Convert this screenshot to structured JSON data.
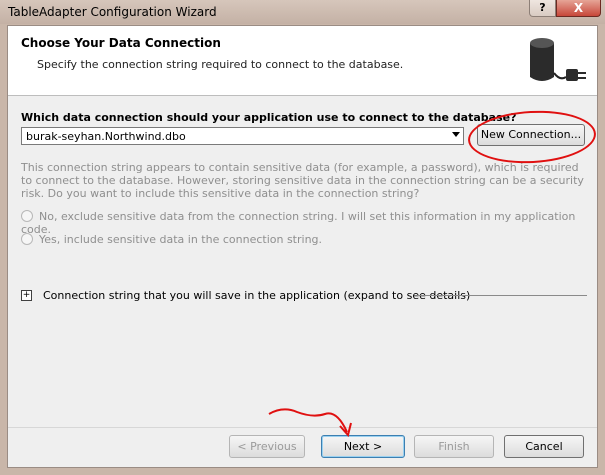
{
  "window": {
    "title": "TableAdapter Configuration Wizard",
    "help_glyph": "?",
    "close_glyph": "X"
  },
  "header": {
    "title": "Choose Your Data Connection",
    "subtitle": "Specify the connection string required to connect to the database."
  },
  "connection": {
    "question": "Which data connection should your application use to connect to the database?",
    "selected_connection": "burak-seyhan.Northwind.dbo",
    "new_connection_label": "New Connection...",
    "sensitive_info": "This connection string appears to contain sensitive data (for example, a password), which is required to connect to the database. However, storing sensitive data in the connection string can be a security risk. Do you want to include this sensitive data in the connection string?",
    "option_exclude": "No, exclude sensitive data from the connection string. I will set this information in my application code.",
    "option_include": "Yes, include sensitive data in the connection string.",
    "expand_glyph": "+",
    "expand_label": "Connection string that you will save in the application (expand to see details)"
  },
  "buttons": {
    "previous": "< Previous",
    "next": "Next >",
    "finish": "Finish",
    "cancel": "Cancel"
  },
  "colors": {
    "annotation": "#e01010"
  }
}
